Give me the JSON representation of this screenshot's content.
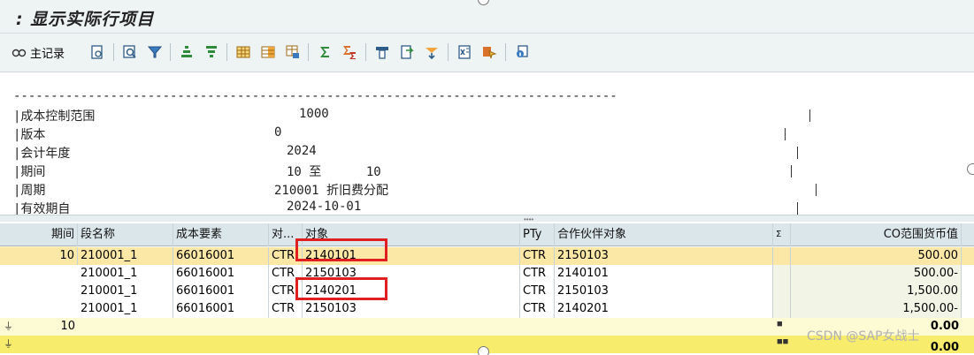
{
  "window": {
    "title": ": 显示实际行项目"
  },
  "toolbar": {
    "master_record_label": "主记录",
    "icons": [
      "master-record-icon",
      "display-document-icon",
      "find-icon",
      "filter-icon",
      "sort-ascending-icon",
      "sort-descending-icon",
      "layout-grid-icon",
      "select-layout-icon",
      "choose-layout-icon",
      "sum-icon",
      "subtotal-icon",
      "print-preview-icon",
      "export-icon",
      "mail-icon",
      "excel-export-icon",
      "graphic-icon",
      "info-icon"
    ]
  },
  "header": {
    "dashes": "---------------------------------------------------------------------------------",
    "fields": [
      {
        "label": "|成本控制范围",
        "value": "1000"
      },
      {
        "label": "|版本",
        "value": "0"
      },
      {
        "label": "|会计年度",
        "value": "2024"
      },
      {
        "label": "|期间",
        "value": "10 至      10"
      },
      {
        "label": "|周期",
        "value": "210001 折旧费分配"
      },
      {
        "label": "|有效期自",
        "value": "2024-10-01"
      }
    ]
  },
  "grid": {
    "columns": [
      "期间",
      "段名称",
      "成本要素",
      "对...",
      "对象",
      "PTy",
      "合作伙伴对象",
      "Σ",
      "CO范围货币值"
    ],
    "rows": [
      {
        "period": "10",
        "segment": "210001_1",
        "element": "66016001",
        "obj_type": "CTR",
        "object": "2140101",
        "pty": "CTR",
        "partner": "2150103",
        "amount": "500.00"
      },
      {
        "period": "",
        "segment": "210001_1",
        "element": "66016001",
        "obj_type": "CTR",
        "object": "2150103",
        "pty": "CTR",
        "partner": "2140101",
        "amount": "500.00-"
      },
      {
        "period": "",
        "segment": "210001_1",
        "element": "66016001",
        "obj_type": "CTR",
        "object": "2140201",
        "pty": "CTR",
        "partner": "2150103",
        "amount": "1,500.00"
      },
      {
        "period": "",
        "segment": "210001_1",
        "element": "66016001",
        "obj_type": "CTR",
        "object": "2150103",
        "pty": "CTR",
        "partner": "2140201",
        "amount": "1,500.00-"
      }
    ],
    "subtotal": {
      "period": "10",
      "amount": "0.00"
    },
    "total": {
      "amount": "0.00"
    }
  },
  "watermark": "CSDN @SAP女战士",
  "colors": {
    "selected_row": "#fbe7a6",
    "subtotal_row": "#fdfbd4",
    "total_row": "#f8ec6d",
    "highlight_box": "#e02020",
    "header_bg": "#dbe6eb"
  }
}
